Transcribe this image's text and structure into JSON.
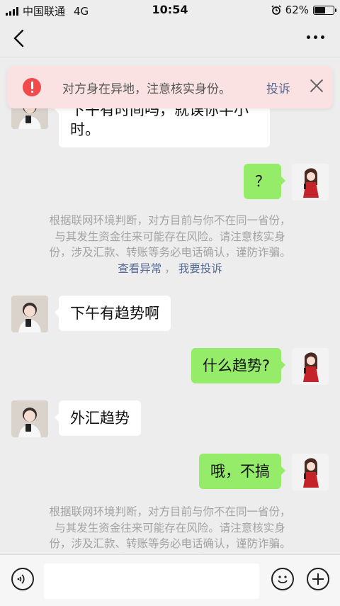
{
  "status_bar": {
    "carrier": "中国联通",
    "network": "4G",
    "time": "10:54",
    "battery": "62%",
    "battery_level": 0.62
  },
  "banner": {
    "message": "对方身在异地，注意核实身份。",
    "complain": "投诉"
  },
  "notice": {
    "text": "根据联网环境判断，对方目前与你不在同一省份，与其发生资金往来可能存在风险。请注意核实身份，涉及汇款、转账等务必电话确认，谨防诈骗。",
    "line1": "根据联网环境判断，对方目前与你不在同一省份，",
    "line2": "与其发生资金往来可能存在风险。请注意核实身",
    "line3": "份，涉及汇款、转账等务必电话确认，谨防诈骗。",
    "link_view": "查看异常",
    "link_sep": "，",
    "link_complain": "我要投诉"
  },
  "messages": [
    {
      "side": "in",
      "text_line1": "下午有时间吗，就误你半小",
      "text_line2": "时。"
    },
    {
      "side": "out",
      "text": "？"
    },
    {
      "side": "in",
      "text": "下午有趋势啊"
    },
    {
      "side": "out",
      "text": "什么趋势?"
    },
    {
      "side": "in",
      "text": "外汇趋势"
    },
    {
      "side": "out",
      "text": "哦，不搞"
    }
  ],
  "colors": {
    "background": "#ededed",
    "outgoing_bubble": "#95ec69",
    "incoming_bubble": "#ffffff",
    "link": "#576b95",
    "banner_bg": "#fbe2e2",
    "warning": "#f24a4a"
  },
  "icons": [
    "back-arrow-icon",
    "more-icon",
    "warning-icon",
    "close-icon",
    "voice-icon",
    "emoji-icon",
    "plus-icon"
  ]
}
